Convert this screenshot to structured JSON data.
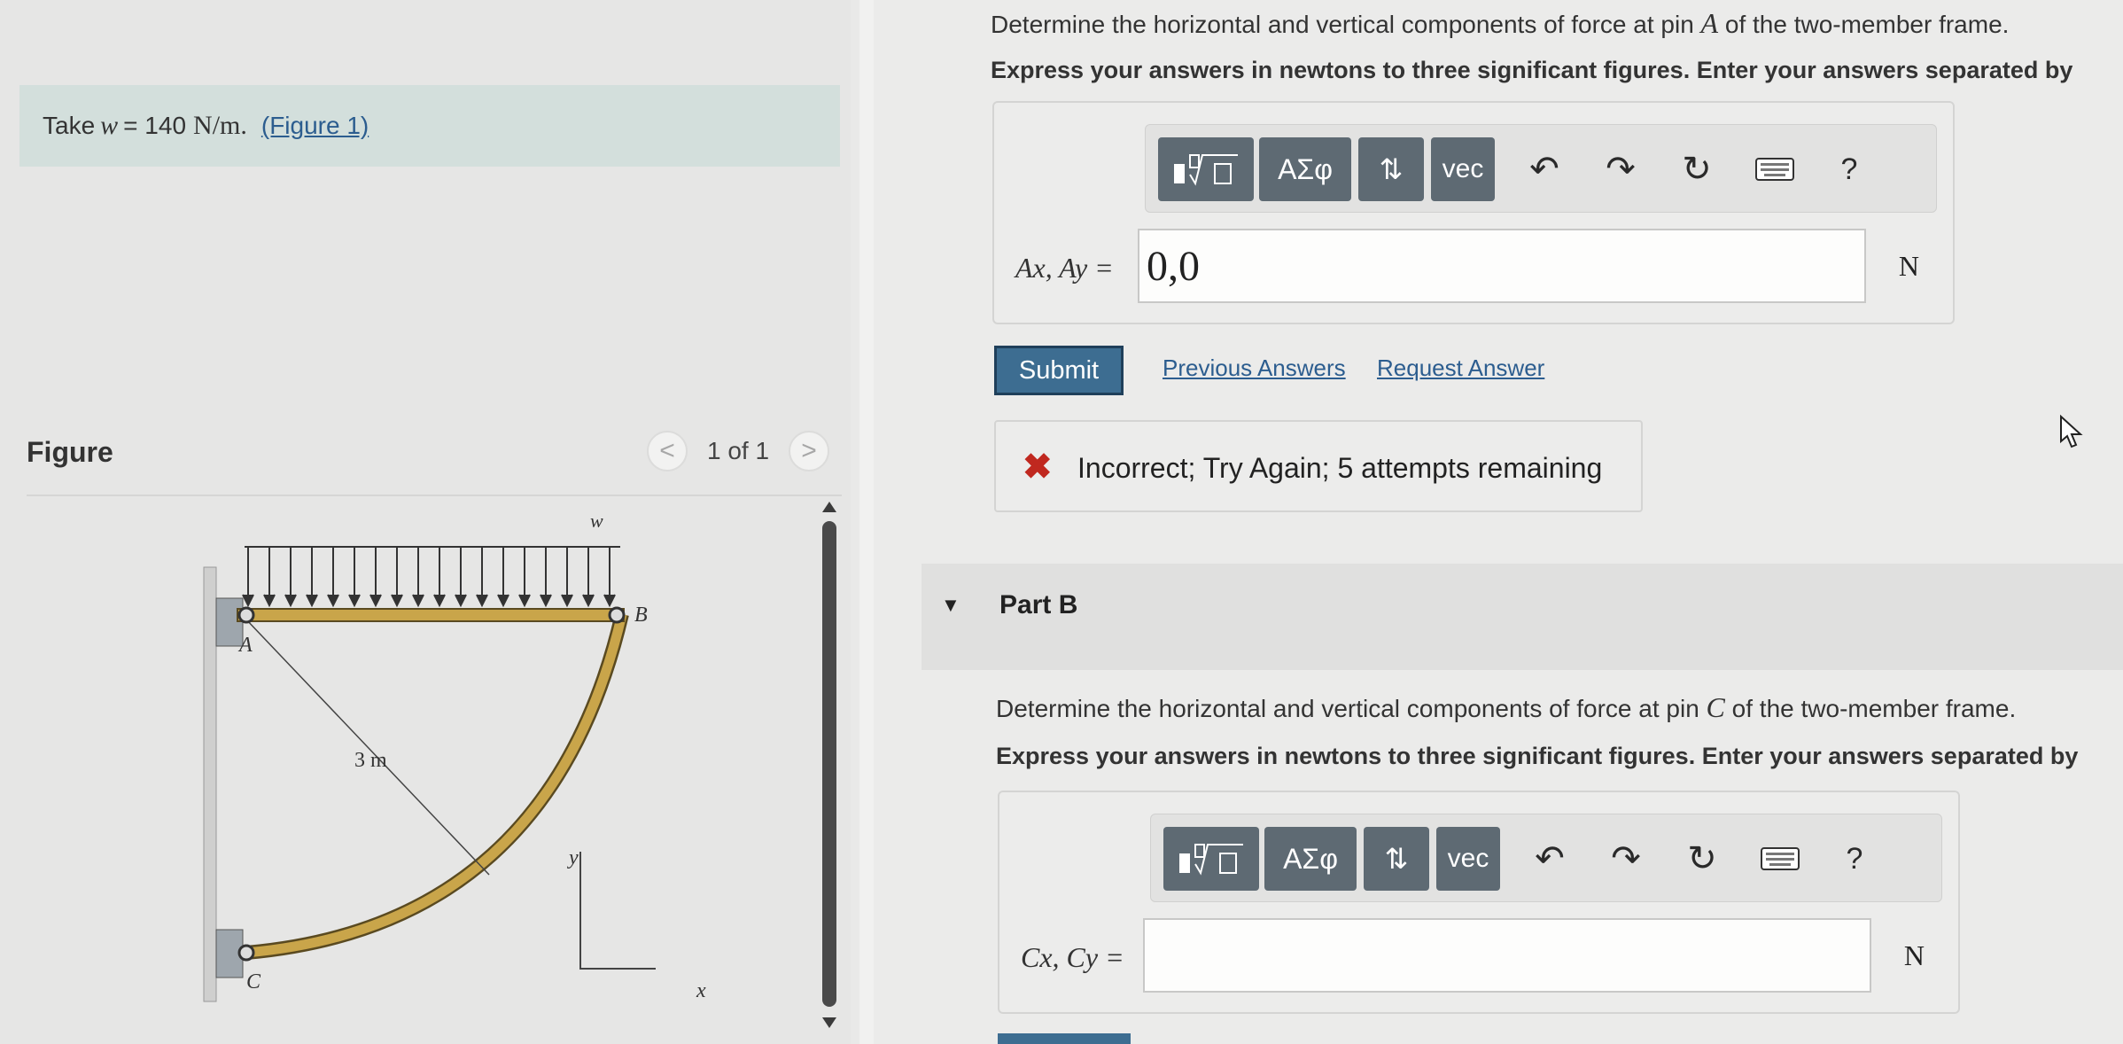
{
  "left_panel": {
    "given": {
      "prefix": "Take",
      "variable": "w",
      "equals": "= 140",
      "unit": "N/m.",
      "figure_link": "(Figure 1)"
    },
    "figure_title": "Figure",
    "pager": {
      "prev": "<",
      "text": "1 of 1",
      "next": ">"
    },
    "figure": {
      "label_w": "w",
      "label_A": "A",
      "label_B": "B",
      "label_C": "C",
      "label_radius": "3 m",
      "label_y": "y",
      "label_x": "x"
    }
  },
  "part_a": {
    "prompt_before": "Determine the horizontal and vertical components of force at pin",
    "prompt_var": "A",
    "prompt_after": "of the two-member frame.",
    "instructions": "Express your answers in newtons to three significant figures. Enter your answers separated by",
    "toolbar": {
      "templates_icon": "templates-icon",
      "greek": "ΑΣφ",
      "arrows": "⇅",
      "vec": "vec",
      "undo": "↶",
      "redo": "↷",
      "reset": "↻",
      "keyboard_icon": "keyboard-icon",
      "help": "?"
    },
    "equation_label": "Ax, Ay =",
    "answer_value": "0,0",
    "unit": "N",
    "submit": "Submit",
    "previous_answers": "Previous Answers",
    "request_answer": "Request Answer",
    "feedback": "Incorrect; Try Again; 5 attempts remaining",
    "feedback_icon": "✖"
  },
  "part_b": {
    "label": "Part B",
    "prompt_before": "Determine the horizontal and vertical components of force at pin",
    "prompt_var": "C",
    "prompt_after": "of the two-member frame.",
    "instructions": "Express your answers in newtons to three significant figures. Enter your answers separated by",
    "toolbar": {
      "greek": "ΑΣφ",
      "arrows": "⇅",
      "vec": "vec",
      "undo": "↶",
      "redo": "↷",
      "reset": "↻",
      "help": "?"
    },
    "equation_label": "Cx, Cy =",
    "answer_value": "",
    "unit": "N"
  },
  "colors": {
    "accent": "#3d6d91",
    "link": "#2c5d8f",
    "error": "#c0281f",
    "toolbar_button": "#5e6a73",
    "beam": "#c9a54a",
    "given_box": "#d3dfdc"
  }
}
